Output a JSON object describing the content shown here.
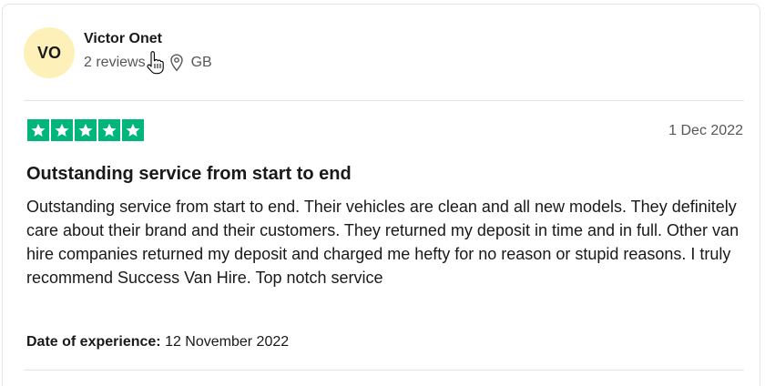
{
  "reviewer": {
    "initials": "VO",
    "name": "Victor Onet",
    "reviews_count": "2 reviews",
    "location": "GB",
    "avatar_color": "#fdf0b8"
  },
  "review": {
    "rating": 5,
    "rating_max": 5,
    "star_color": "#00b67a",
    "date": "1 Dec 2022",
    "title": "Outstanding service from start to end",
    "body": "Outstanding service from start to end. Their vehicles are clean and all new models. They definitely care about their brand and their customers. They returned my deposit in time and in full. Other van hire companies returned my deposit and charged me hefty for no reason or stupid reasons. I truly recommend Success Van Hire. Top notch service",
    "experience_label": "Date of experience:",
    "experience_date": "12 November 2022"
  },
  "icons": {
    "location": "map-pin-icon",
    "cursor": "hand-pointer-icon",
    "star": "star-icon"
  }
}
